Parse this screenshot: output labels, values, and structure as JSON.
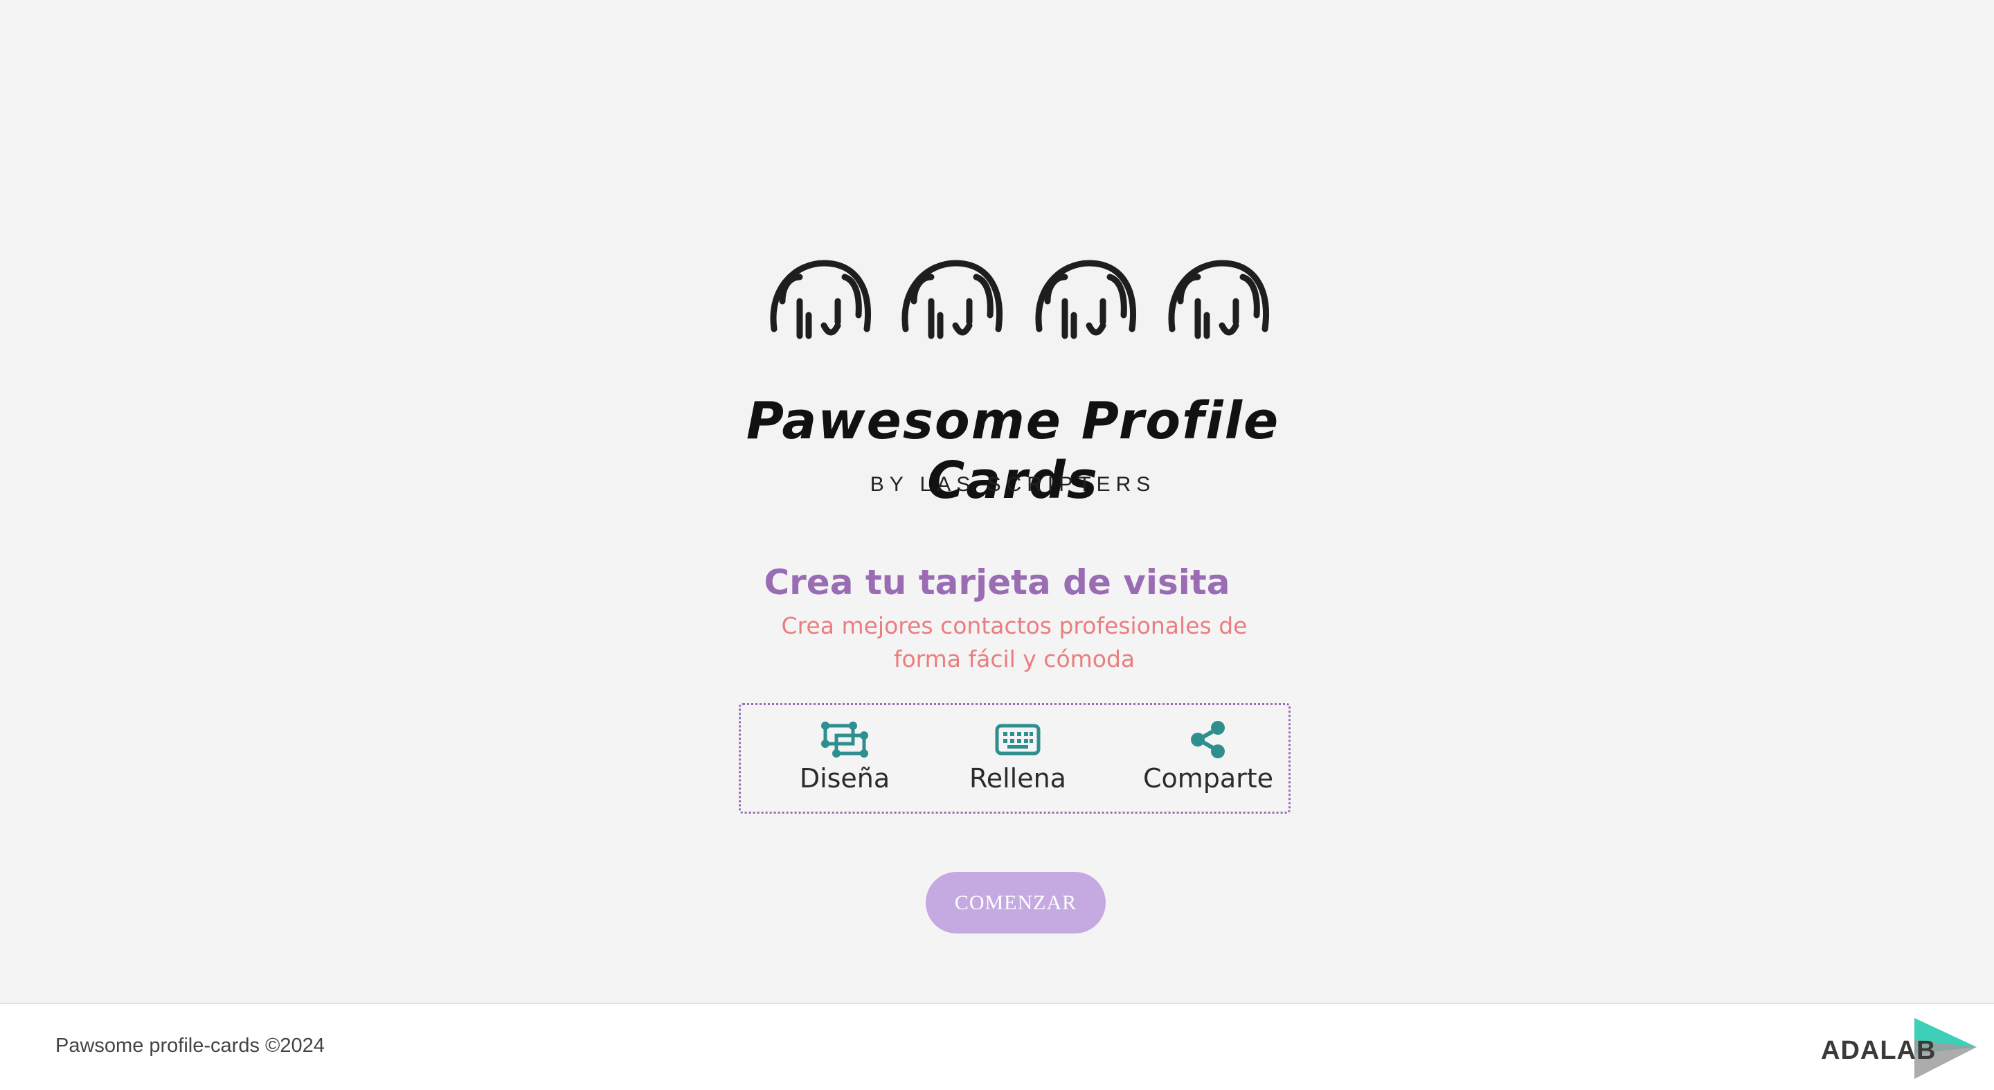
{
  "logo": {
    "title": "Pawesome Profile Cards",
    "subtitle": "BY LAS SCRIPTERS",
    "dog_icon": "dog-face-icon"
  },
  "hero": {
    "title": "Crea tu tarjeta de visita",
    "subtitle": "Crea mejores contactos profesionales de forma fácil y cómoda"
  },
  "steps": [
    {
      "icon": "object-group-icon",
      "label": "Diseña"
    },
    {
      "icon": "keyboard-icon",
      "label": "Rellena"
    },
    {
      "icon": "share-icon",
      "label": "Comparte"
    }
  ],
  "cta": {
    "label": "COMENZAR"
  },
  "footer": {
    "copyright": "Pawsome profile-cards ©2024",
    "brand": "ADALAB"
  },
  "colors": {
    "accent_purple": "#9a6cb4",
    "accent_coral": "#e97e80",
    "icon_teal": "#2f8f8f",
    "button": "#c5a9e1",
    "background": "#f4f4f4"
  }
}
